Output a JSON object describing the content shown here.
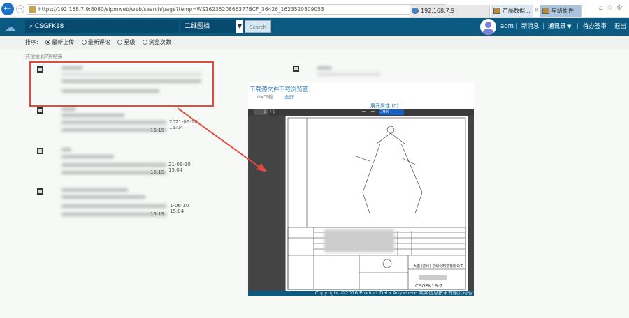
{
  "browser": {
    "url": "https://192.168.7.9:8080/sipmweb/web/search/page?temp=WS1623520866377BCF_36426_1623520809053",
    "tabs": [
      {
        "label": "192.168.7.9"
      },
      {
        "label": "产品数据..."
      },
      {
        "label": "星级组件"
      }
    ],
    "tab_close": "×"
  },
  "header": {
    "query": "CSGFK18",
    "type": "二维图档",
    "search_label": "Search",
    "user": "adm",
    "links": [
      "新消息",
      "通讯录",
      "待办签审",
      "退出"
    ]
  },
  "sort": {
    "label": "排序:",
    "options": [
      {
        "label": "最新上传",
        "selected": true
      },
      {
        "label": "最新评论",
        "selected": false
      },
      {
        "label": "星级",
        "selected": false
      },
      {
        "label": "浏览次数",
        "selected": false
      }
    ]
  },
  "results": {
    "count_text": "共搜索到7条结果",
    "items": [
      {
        "date1": "",
        "date2": ""
      },
      {
        "date1": "2021-06-10 15:04",
        "date2": "15:19"
      },
      {
        "date1": "21-06-10 15:04",
        "date2": "15:19"
      },
      {
        "date1": "1-06-10 15:04",
        "date2": "15:19"
      }
    ]
  },
  "preview": {
    "download_source": "下载源文件",
    "download_preview": "下载浏览图",
    "ux_download": "UX下载",
    "fullscreen": "全屏",
    "expand_props": "展开属性 (0)",
    "page_current": "1",
    "page_total": "/ 1",
    "zoom": "79%",
    "drawing_code": "CSGFK18-2",
    "company": "大連 (苏州) 自动化制造有限公司",
    "copyright": "Copyright ©2016 Product Data Anywhere 某某信息技术有限公司版"
  },
  "colors": {
    "header": "#0b5a82",
    "highlight": "#e24a3f"
  }
}
